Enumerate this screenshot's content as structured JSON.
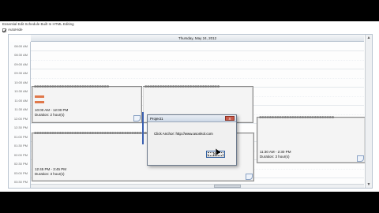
{
  "app": {
    "window_title": "Essential Edit Schedule Built In HTML Editing",
    "autohide_label": "AutoHide"
  },
  "scheduler": {
    "day_header": "Thursday, May 24, 2012",
    "time_labels": [
      "08:00 AM",
      "08:30 AM",
      "09:00 AM",
      "09:30 AM",
      "10:00 AM",
      "10:30 AM",
      "11:00 AM",
      "11:30 AM",
      "12:00 PM",
      "12:30 PM",
      "01:00 PM",
      "01:30 PM",
      "02:00 PM",
      "02:30 PM",
      "03:00 PM",
      "03:30 PM"
    ],
    "appointments": [
      {
        "time": "10:00 AM - 12:00 PM",
        "duration": "Duration: 2 hour(s)"
      },
      {
        "time": "12:45 PM - 3:45 PM",
        "duration": "Duration: 3 hour(s)"
      },
      {
        "time": "11:30 AM - 2:30 PM",
        "duration": "Duration: 3 hour(s)"
      }
    ]
  },
  "dialog": {
    "title": "Project1",
    "close_label": "X",
    "message": "Click Anchor: http://www.asonkol.com",
    "ok_label": "OK"
  },
  "colors": {
    "tag_color": "#e0784a",
    "selection_bar": "#3a5fb0"
  }
}
